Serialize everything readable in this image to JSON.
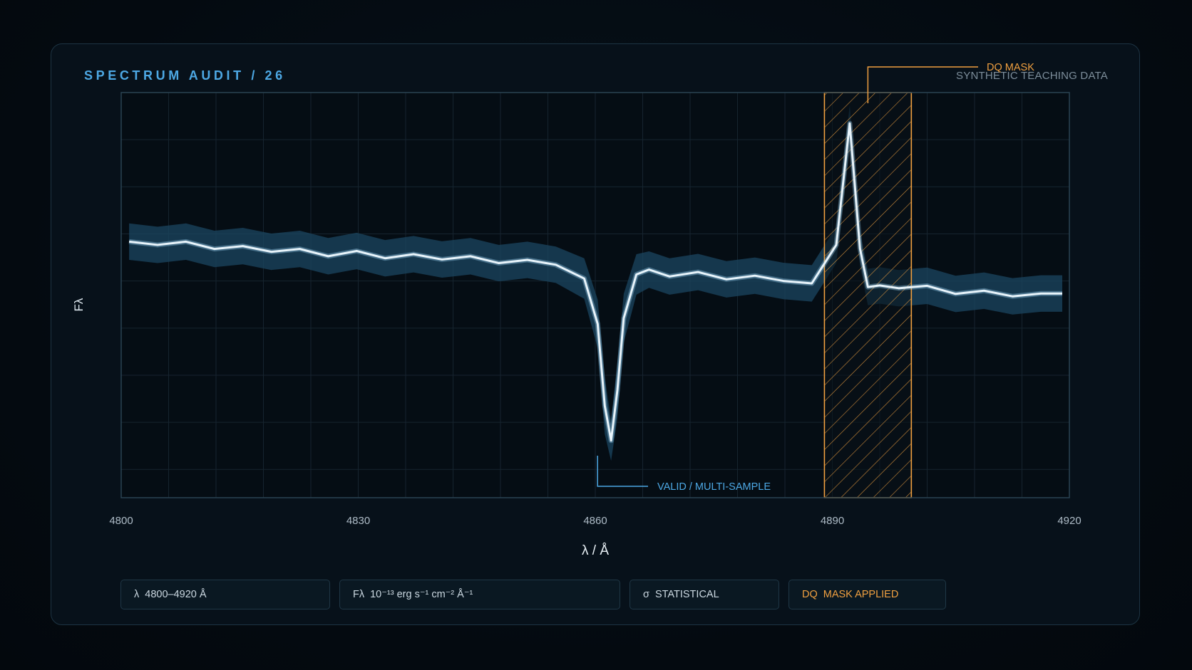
{
  "header": {
    "title": "SPECTRUM AUDIT / 26",
    "watermark": "SYNTHETIC TEACHING DATA"
  },
  "annotations": {
    "mask_label": "DQ MASK",
    "valid_label": "VALID / MULTI-SAMPLE"
  },
  "axes": {
    "ylabel": "Fλ",
    "xlabel": "λ / Å"
  },
  "chips": [
    {
      "symbol": "λ",
      "text": "4800–4920 Å"
    },
    {
      "symbol": "Fλ",
      "text": "10⁻¹³ erg s⁻¹ cm⁻² Å⁻¹"
    },
    {
      "symbol": "σ",
      "text": "STATISTICAL"
    },
    {
      "symbol": "DQ",
      "text": "MASK APPLIED"
    }
  ],
  "colors": {
    "accent": "#4da8e4",
    "mask": "#f0a040",
    "line": "#e8f4fb",
    "band": "#1b4560"
  },
  "chart_data": {
    "type": "line",
    "xlim": [
      4800,
      4920
    ],
    "xticks": [
      "4800",
      "4830",
      "4860",
      "4890",
      "4920"
    ],
    "ylim": [
      0,
      1
    ],
    "grid": true,
    "mask_region": [
      4889,
      4900
    ],
    "series": [
      {
        "x": [
          4801,
          4804.6,
          4808.2,
          4811.8,
          4815.4,
          4819,
          4822.6,
          4826.2,
          4829.8,
          4833.4,
          4837,
          4840.6,
          4844.2,
          4847.8,
          4851.4,
          4855,
          4858.6,
          4860.3,
          4861.2,
          4862,
          4862.8,
          4863.6,
          4865.2,
          4866.8,
          4869.4,
          4873,
          4876.6,
          4880.2,
          4883.8,
          4887.4,
          4890.5,
          4892.2,
          4893.5,
          4894.5,
          4896,
          4898.4,
          4902,
          4905.6,
          4909.2,
          4912.8,
          4916.4,
          4919.1
        ],
        "y": [
          0.632,
          0.624,
          0.632,
          0.614,
          0.621,
          0.607,
          0.614,
          0.596,
          0.609,
          0.591,
          0.601,
          0.588,
          0.596,
          0.579,
          0.587,
          0.575,
          0.541,
          0.429,
          0.227,
          0.141,
          0.266,
          0.443,
          0.551,
          0.563,
          0.546,
          0.557,
          0.539,
          0.548,
          0.535,
          0.529,
          0.624,
          0.924,
          0.615,
          0.52,
          0.524,
          0.517,
          0.523,
          0.503,
          0.511,
          0.497,
          0.504,
          0.504
        ],
        "err": [
          0.045,
          0.045,
          0.045,
          0.045,
          0.045,
          0.045,
          0.045,
          0.045,
          0.045,
          0.045,
          0.045,
          0.045,
          0.045,
          0.045,
          0.045,
          0.045,
          0.05,
          0.06,
          0.07,
          0.05,
          0.07,
          0.06,
          0.05,
          0.045,
          0.045,
          0.045,
          0.045,
          0.045,
          0.045,
          0.045,
          0.045,
          0.045,
          0.045,
          0.045,
          0.045,
          0.045,
          0.045,
          0.045,
          0.045,
          0.045,
          0.045,
          0.045
        ]
      }
    ]
  }
}
